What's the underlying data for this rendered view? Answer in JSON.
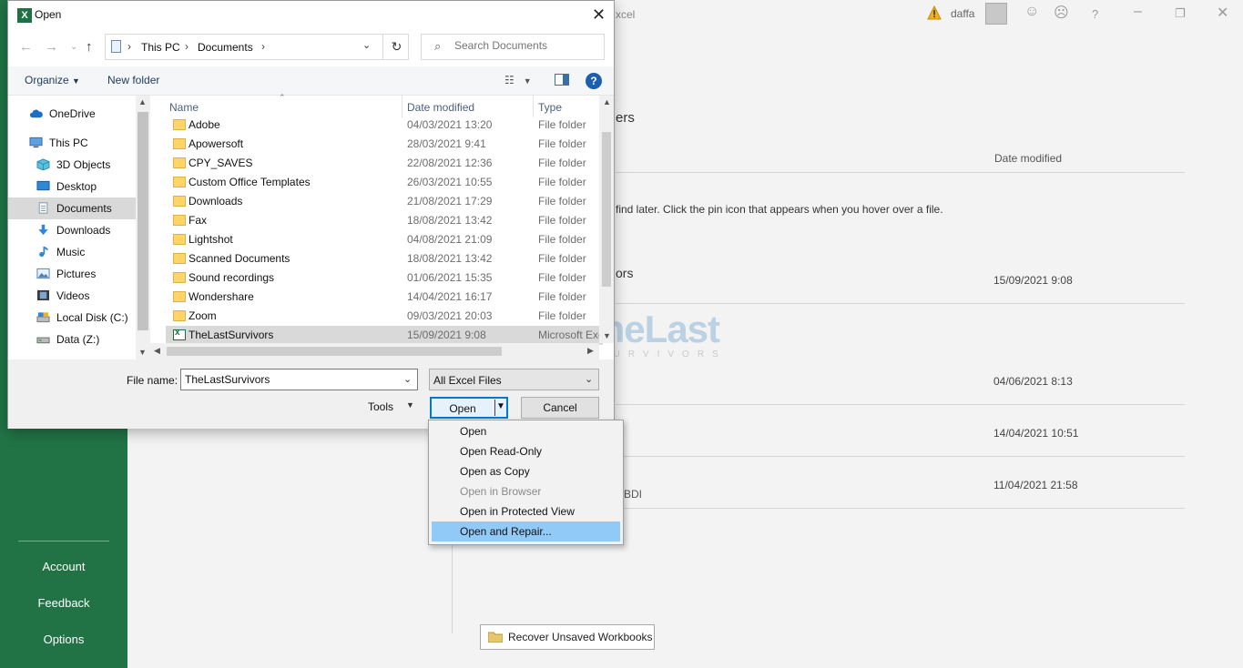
{
  "excel": {
    "app_title_fragment": "xcel",
    "user_name": "daffa",
    "sidebar": {
      "items": [
        {
          "label": "Account"
        },
        {
          "label": "Feedback"
        },
        {
          "label": "Options"
        }
      ]
    },
    "main": {
      "partial_heading": "ers",
      "column_date": "Date modified",
      "pin_hint": "find later. Click the pin icon that appears when you hover over a file.",
      "recent": [
        {
          "name_fragment": "ors",
          "date": "15/09/2021 9:08"
        },
        {
          "name_fragment": "",
          "date": "04/06/2021 8:13"
        },
        {
          "name_fragment": "",
          "date": "14/04/2021 10:51"
        },
        {
          "name_fragment": "BDI",
          "date": "11/04/2021 21:58"
        }
      ],
      "recover_button": "Recover Unsaved Workbooks"
    },
    "watermark": {
      "title": "TheLast",
      "subtitle": "SURVIVORS"
    }
  },
  "dialog": {
    "title": "Open",
    "breadcrumb": [
      "This PC",
      "Documents"
    ],
    "search_placeholder": "Search Documents",
    "toolbar": {
      "organize": "Organize",
      "new_folder": "New folder"
    },
    "nav_items": [
      {
        "label": "OneDrive",
        "icon": "cloud-icon"
      },
      {
        "label": "This PC",
        "icon": "monitor-icon"
      },
      {
        "label": "3D Objects",
        "icon": "cube-icon"
      },
      {
        "label": "Desktop",
        "icon": "desktop-icon"
      },
      {
        "label": "Documents",
        "icon": "document-icon"
      },
      {
        "label": "Downloads",
        "icon": "download-icon"
      },
      {
        "label": "Music",
        "icon": "music-icon"
      },
      {
        "label": "Pictures",
        "icon": "pictures-icon"
      },
      {
        "label": "Videos",
        "icon": "videos-icon"
      },
      {
        "label": "Local Disk (C:)",
        "icon": "drive-icon"
      },
      {
        "label": "Data (Z:)",
        "icon": "drive-icon"
      }
    ],
    "columns": {
      "name": "Name",
      "date": "Date modified",
      "type": "Type"
    },
    "files": [
      {
        "name": "Adobe",
        "date": "04/03/2021 13:20",
        "type": "File folder"
      },
      {
        "name": "Apowersoft",
        "date": "28/03/2021 9:41",
        "type": "File folder"
      },
      {
        "name": "CPY_SAVES",
        "date": "22/08/2021 12:36",
        "type": "File folder"
      },
      {
        "name": "Custom Office Templates",
        "date": "26/03/2021 10:55",
        "type": "File folder"
      },
      {
        "name": "Downloads",
        "date": "21/08/2021 17:29",
        "type": "File folder"
      },
      {
        "name": "Fax",
        "date": "18/08/2021 13:42",
        "type": "File folder"
      },
      {
        "name": "Lightshot",
        "date": "04/08/2021 21:09",
        "type": "File folder"
      },
      {
        "name": "Scanned Documents",
        "date": "18/08/2021 13:42",
        "type": "File folder"
      },
      {
        "name": "Sound recordings",
        "date": "01/06/2021 15:35",
        "type": "File folder"
      },
      {
        "name": "Wondershare",
        "date": "14/04/2021 16:17",
        "type": "File folder"
      },
      {
        "name": "Zoom",
        "date": "09/03/2021 20:03",
        "type": "File folder"
      },
      {
        "name": "TheLastSurvivors",
        "date": "15/09/2021 9:08",
        "type": "Microsoft Exc"
      }
    ],
    "file_name_label": "File name:",
    "file_name_value": "TheLastSurvivors",
    "file_type_filter": "All Excel Files",
    "tools_label": "Tools",
    "open_label": "Open",
    "cancel_label": "Cancel",
    "open_menu": [
      {
        "label": "Open",
        "state": "normal"
      },
      {
        "label": "Open Read-Only",
        "state": "normal"
      },
      {
        "label": "Open as Copy",
        "state": "normal"
      },
      {
        "label": "Open in Browser",
        "state": "disabled"
      },
      {
        "label": "Open in Protected View",
        "state": "normal"
      },
      {
        "label": "Open and Repair...",
        "state": "highlighted"
      }
    ]
  },
  "colors": {
    "excel_green": "#217346",
    "menu_highlight": "#91c9f7",
    "selection_gray": "#d9d9d9",
    "folder_yellow": "#ffd567",
    "accent_blue": "#0078d7"
  }
}
